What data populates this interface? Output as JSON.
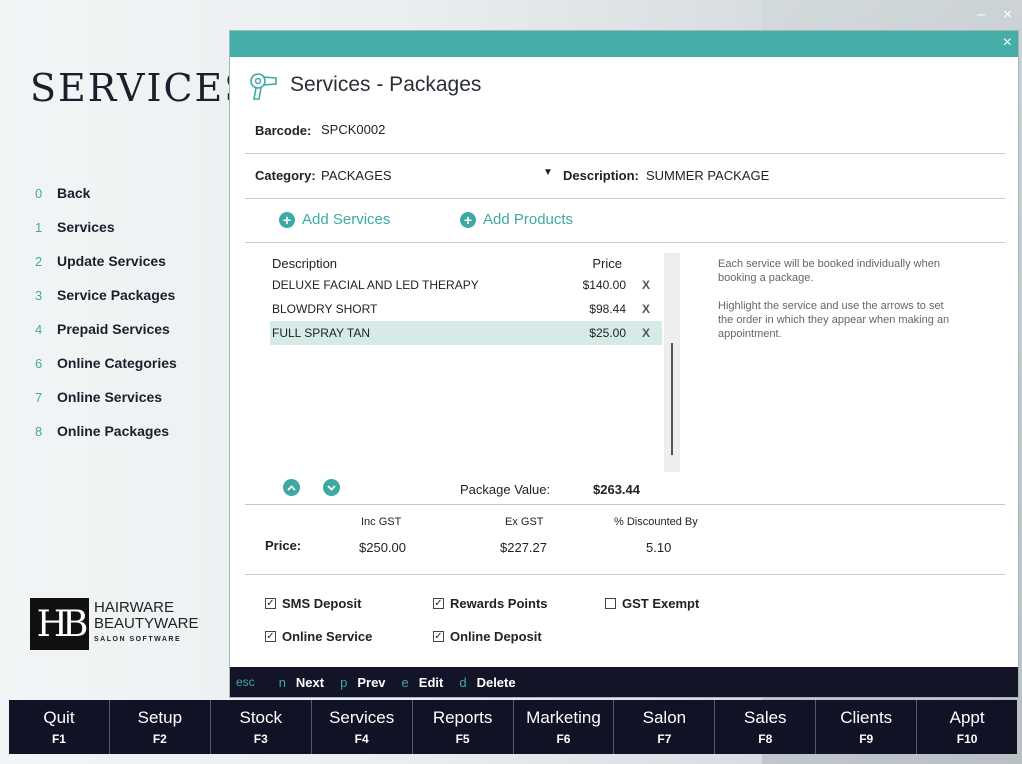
{
  "window": {
    "minimize": "–",
    "close": "×"
  },
  "left_panel": {
    "title": "SERVICES",
    "nav": [
      {
        "num": "0",
        "label": "Back"
      },
      {
        "num": "1",
        "label": "Services"
      },
      {
        "num": "2",
        "label": "Update Services"
      },
      {
        "num": "3",
        "label": "Service Packages"
      },
      {
        "num": "4",
        "label": "Prepaid Services"
      },
      {
        "num": "6",
        "label": "Online Categories"
      },
      {
        "num": "7",
        "label": "Online Services"
      },
      {
        "num": "8",
        "label": "Online Packages"
      }
    ],
    "logo": {
      "mark": "HB",
      "line1": "HAIRWARE",
      "line2": "BEAUTYWARE",
      "line3": "SALON SOFTWARE"
    }
  },
  "dialog": {
    "title": "Services - Packages",
    "close": "×",
    "barcode_label": "Barcode:",
    "barcode_value": "SPCK0002",
    "category_label": "Category:",
    "category_value": "PACKAGES",
    "description_label": "Description:",
    "description_value": "SUMMER PACKAGE",
    "add_services": "Add Services",
    "add_products": "Add Products",
    "table": {
      "headers": {
        "description": "Description",
        "price": "Price"
      },
      "rows": [
        {
          "description": "DELUXE FACIAL AND LED THERAPY",
          "price": "$140.00",
          "remove": "X"
        },
        {
          "description": "BLOWDRY SHORT",
          "price": "$98.44",
          "remove": "X"
        },
        {
          "description": "FULL SPRAY TAN",
          "price": "$25.00",
          "remove": "X"
        }
      ],
      "selected_row": 2
    },
    "help_text_1": "Each service will be booked individually when booking a package.",
    "help_text_2": "Highlight the service and use the arrows to set the order in which they appear when making an appointment.",
    "package_value_label": "Package Value:",
    "package_value": "$263.44",
    "price_label": "Price:",
    "inc_gst_label": "Inc GST",
    "inc_gst_value": "$250.00",
    "ex_gst_label": "Ex GST",
    "ex_gst_value": "$227.27",
    "discount_label": "% Discounted By",
    "discount_value": "5.10",
    "checkboxes": {
      "sms_deposit": {
        "label": "SMS Deposit",
        "checked": true
      },
      "rewards_points": {
        "label": "Rewards Points",
        "checked": true
      },
      "gst_exempt": {
        "label": "GST Exempt",
        "checked": false
      },
      "online_service": {
        "label": "Online Service",
        "checked": true
      },
      "online_deposit": {
        "label": "Online Deposit",
        "checked": true
      }
    },
    "shortcuts": {
      "esc": "esc",
      "items": [
        {
          "key": "n",
          "label": "Next"
        },
        {
          "key": "p",
          "label": "Prev"
        },
        {
          "key": "e",
          "label": "Edit"
        },
        {
          "key": "d",
          "label": "Delete"
        }
      ]
    }
  },
  "function_keys": [
    {
      "name": "Quit",
      "key": "F1"
    },
    {
      "name": "Setup",
      "key": "F2"
    },
    {
      "name": "Stock",
      "key": "F3"
    },
    {
      "name": "Services",
      "key": "F4"
    },
    {
      "name": "Reports",
      "key": "F5"
    },
    {
      "name": "Marketing",
      "key": "F6"
    },
    {
      "name": "Salon",
      "key": "F7"
    },
    {
      "name": "Sales",
      "key": "F8"
    },
    {
      "name": "Clients",
      "key": "F9"
    },
    {
      "name": "Appt",
      "key": "F10"
    }
  ],
  "colors": {
    "accent": "#47aea7",
    "dark_bar": "#121226",
    "selected_row": "#d6ebe8"
  }
}
